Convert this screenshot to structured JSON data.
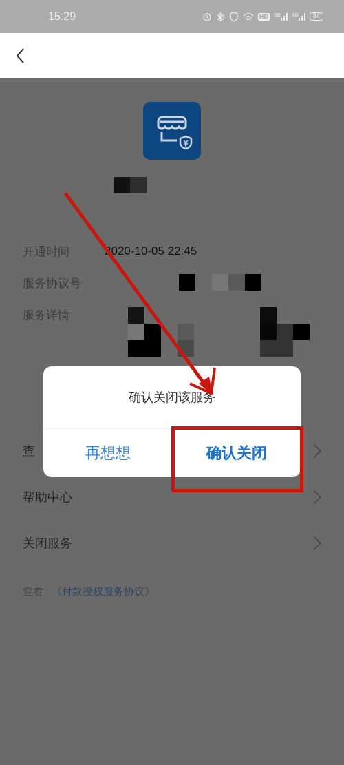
{
  "status_bar": {
    "time": "15:29",
    "hd": "HD",
    "net1": "5G",
    "net2": "4G",
    "battery": "84"
  },
  "info_rows": [
    {
      "label": "开通时间",
      "value": "2020-10-05 22:45"
    },
    {
      "label": "服务协议号"
    },
    {
      "label": "服务详情"
    }
  ],
  "menu_items": [
    {
      "label": "查"
    },
    {
      "label": "帮助中心"
    },
    {
      "label": "关闭服务"
    }
  ],
  "agreement": {
    "prefix": "查看",
    "link": "《付款授权服务协议》"
  },
  "dialog": {
    "title": "确认关闭该服务",
    "buttons": [
      {
        "label": "再想想",
        "highlighted": false
      },
      {
        "label": "确认关闭",
        "highlighted": true
      }
    ]
  }
}
